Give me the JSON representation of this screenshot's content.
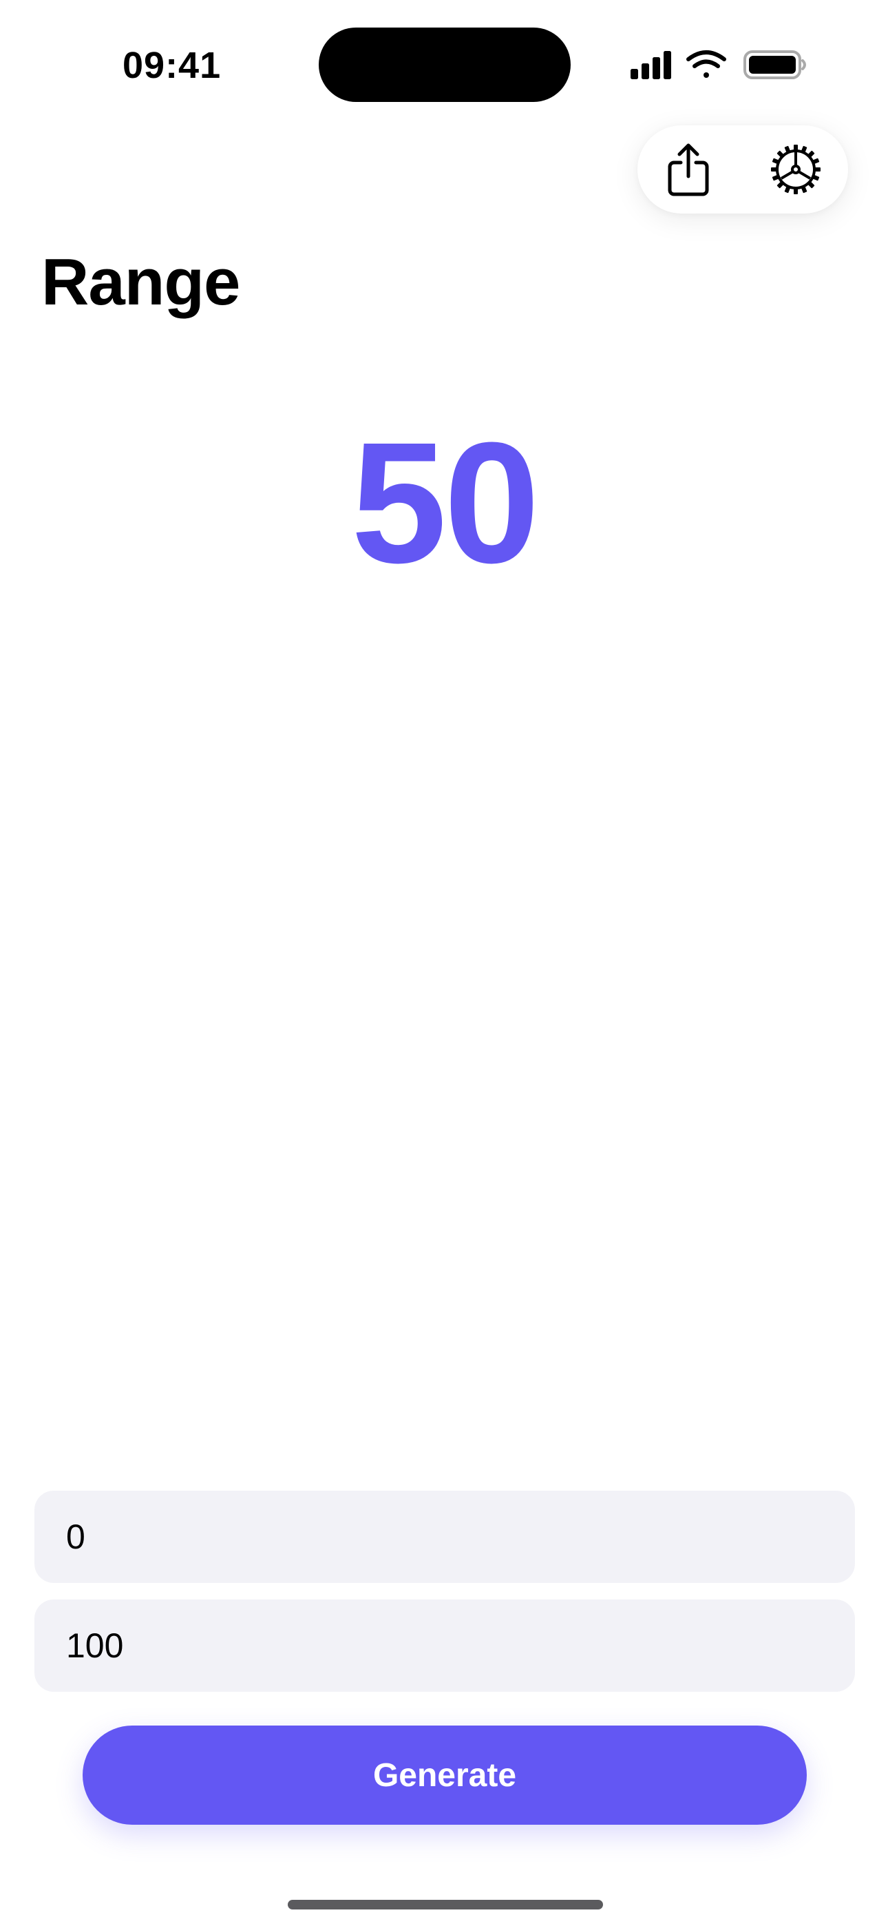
{
  "status_bar": {
    "time": "09:41"
  },
  "toolbar": {
    "share_icon": "share-icon",
    "settings_icon": "gear-icon"
  },
  "page": {
    "title": "Range"
  },
  "result": {
    "value": "50"
  },
  "inputs": {
    "min": {
      "value": "0"
    },
    "max": {
      "value": "100"
    }
  },
  "actions": {
    "generate_label": "Generate"
  },
  "colors": {
    "accent": "#6357f3",
    "field_background": "#f2f2f7",
    "text": "#000000"
  }
}
